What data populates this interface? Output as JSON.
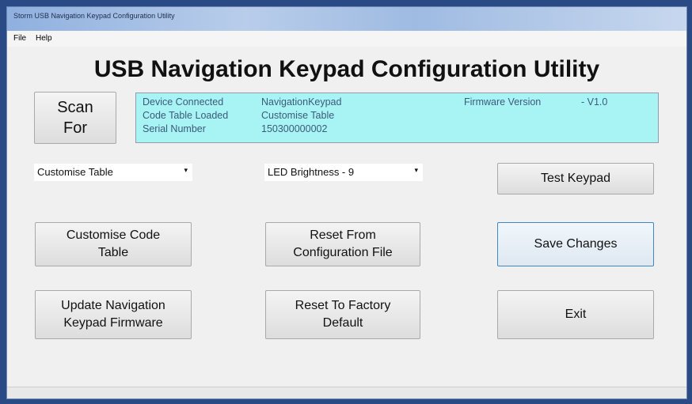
{
  "window": {
    "title": "Storm USB Navigation Keypad Configuration Utility"
  },
  "menu": {
    "items": [
      "File",
      "Help"
    ]
  },
  "heading": "USB Navigation Keypad Configuration Utility",
  "scan_button": {
    "line1": "Scan",
    "line2": "For"
  },
  "info": {
    "device_label": "Device Connected",
    "device_value": "NavigationKeypad",
    "firmware_label": "Firmware Version",
    "firmware_value": "-  V1.0",
    "table_label": "Code Table Loaded",
    "table_value": "Customise Table",
    "serial_label": "Serial Number",
    "serial_value": "150300000002"
  },
  "dropdowns": {
    "table_select": "Customise Table",
    "brightness_select": "LED Brightness - 9"
  },
  "buttons": {
    "test_keypad": "Test Keypad",
    "customise_line1": "Customise Code",
    "customise_line2": "Table",
    "reset_config_line1": "Reset From",
    "reset_config_line2": "Configuration File",
    "save_changes": "Save Changes",
    "update_fw_line1": "Update Navigation",
    "update_fw_line2": "Keypad Firmware",
    "reset_factory_line1": "Reset To Factory",
    "reset_factory_line2": "Default",
    "exit": "Exit"
  },
  "icons": {
    "dropdown_arrow": "▾"
  }
}
